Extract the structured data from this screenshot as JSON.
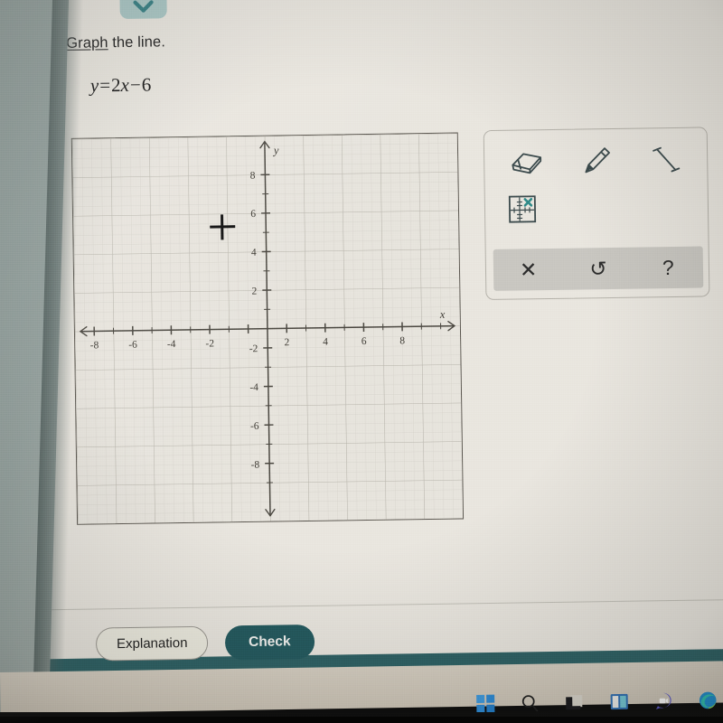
{
  "header": {
    "chevron_icon": "chevron-down-icon",
    "prompt_link": "Graph",
    "prompt_rest": " the line."
  },
  "problem": {
    "equation_lhs": "y",
    "equation_eq": "=",
    "equation_coef": "2",
    "equation_var": "x",
    "equation_minus": "−",
    "equation_const": "6",
    "equation_plain": "y = 2x − 6"
  },
  "chart_data": {
    "type": "line",
    "title": "",
    "xlabel": "x",
    "ylabel": "y",
    "xlim": [
      -10,
      10
    ],
    "ylim": [
      -10,
      10
    ],
    "grid": true,
    "minor_grid_step": 0.5,
    "major_grid_step": 2,
    "tick_step": 1,
    "xticks": [
      -8,
      -6,
      -4,
      -2,
      2,
      4,
      6,
      8
    ],
    "yticks": [
      8,
      6,
      4,
      2,
      -2,
      -4,
      -6,
      -8
    ],
    "xtick_labels": [
      "-8",
      "-6",
      "-4",
      "-2",
      "2",
      "4",
      "6",
      "8"
    ],
    "ytick_labels": [
      "8",
      "6",
      "4",
      "2",
      "-2",
      "-4",
      "-6",
      "-8"
    ],
    "axis_arrows": true,
    "series": [
      {
        "name": "y = 2x - 6",
        "slope": 2,
        "intercept": -6,
        "drawn": false,
        "values": []
      }
    ],
    "cursor": {
      "type": "crosshair",
      "x": -2.4,
      "y": 5.5
    }
  },
  "palette": {
    "tools": [
      {
        "id": "eraser",
        "icon": "eraser-icon",
        "label": "Eraser"
      },
      {
        "id": "pencil",
        "icon": "pencil-icon",
        "label": "Pencil"
      },
      {
        "id": "line",
        "icon": "line-segment-icon",
        "label": "Line"
      },
      {
        "id": "delete-point",
        "icon": "graph-delete-icon",
        "label": "Delete point"
      }
    ],
    "actions": [
      {
        "id": "clear",
        "glyph": "✕",
        "icon": "close-icon",
        "label": "Clear"
      },
      {
        "id": "undo",
        "glyph": "↺",
        "icon": "undo-icon",
        "label": "Undo"
      },
      {
        "id": "help",
        "glyph": "?",
        "icon": "help-icon",
        "label": "Help"
      }
    ]
  },
  "footer": {
    "explanation_label": "Explanation",
    "check_label": "Check"
  },
  "taskbar": {
    "items": [
      {
        "id": "start",
        "icon": "windows-start-icon"
      },
      {
        "id": "search",
        "icon": "search-icon"
      },
      {
        "id": "task-view",
        "icon": "task-view-icon"
      },
      {
        "id": "widgets",
        "icon": "widgets-icon"
      },
      {
        "id": "teams",
        "icon": "teams-chat-icon"
      },
      {
        "id": "edge",
        "icon": "edge-browser-icon"
      }
    ]
  },
  "colors": {
    "page_bg": "#e9e6df",
    "accent_teal": "#23595e",
    "chevron_bg": "#a7c6c4",
    "footer_band": "#2d6064",
    "grid_line": "#c8c5bc",
    "axis": "#4a4740",
    "tool_stroke": "#3b4a4c"
  }
}
